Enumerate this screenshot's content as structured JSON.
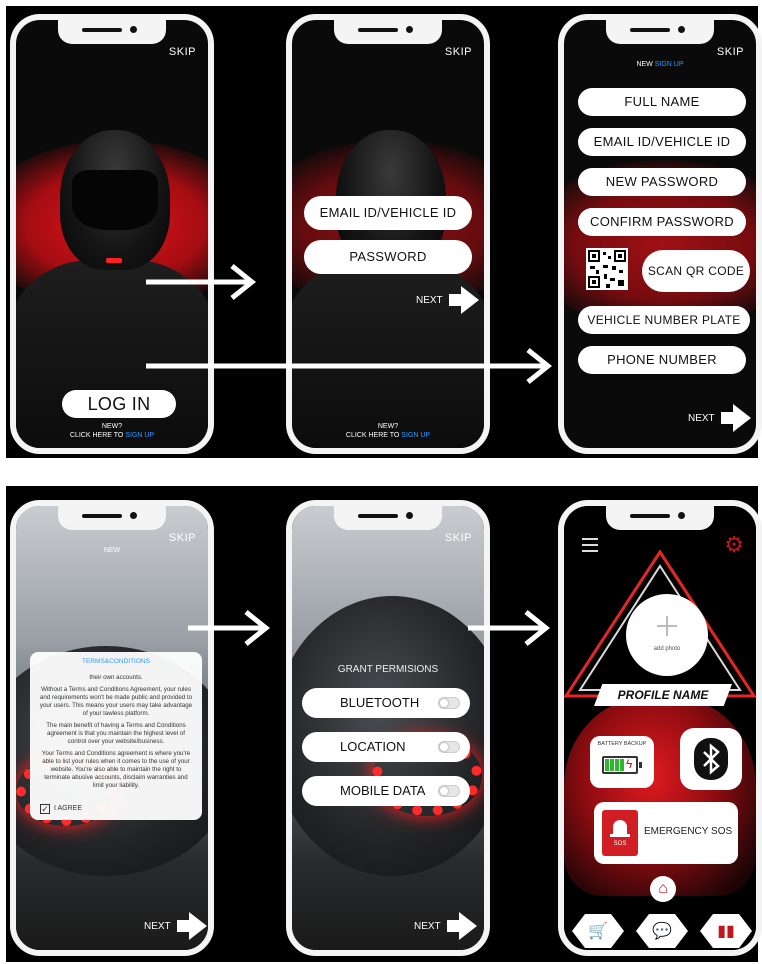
{
  "screens": {
    "login": {
      "skip": "SKIP",
      "login_button": "LOG IN",
      "new_line": "NEW?",
      "click_here": "CLICK HERE TO ",
      "sign_up": "SIGN UP"
    },
    "credentials": {
      "skip": "SKIP",
      "email_field": "EMAIL ID/VEHICLE ID",
      "password_field": "PASSWORD",
      "next": "NEXT",
      "new_line": "NEW?",
      "click_here": "CLICK HERE TO ",
      "sign_up": "SIGN UP"
    },
    "signup": {
      "skip": "SKIP",
      "title_prefix": "NEW ",
      "title_accent": "SIGN UP",
      "full_name": "FULL NAME",
      "email": "EMAIL ID/VEHICLE ID",
      "new_password": "NEW PASSWORD",
      "confirm_password": "CONFIRM PASSWORD",
      "scan_qr": "SCAN QR CODE",
      "vehicle_plate": "VEHICLE NUMBER PLATE",
      "phone": "PHONE NUMBER",
      "next": "NEXT"
    },
    "terms": {
      "skip": "SKIP",
      "title_prefix": "NEW ",
      "heading": "TERMS&CONDITIONS",
      "p1": "their own accounts.",
      "p2": "Without a Terms and Conditions Agreement, your rules and requirements won't be made public and provided to your users. This means your users may take advantage of your lawless platform.",
      "p3": "The main benefit of having a Terms and Conditions agreement is that you maintain the highest level of control over your website/business.",
      "p4": "Your Terms and Conditions agreement is where you're able to list your rules when it comes to the use of your website. You're also able to maintain the right to terminate abusive accounts, disclaim warranties and limit your liability.",
      "agree": "I AGREE",
      "next": "NEXT"
    },
    "permissions": {
      "skip": "SKIP",
      "heading": "GRANT PERMISIONS",
      "bluetooth": "BLUETOOTH",
      "location": "LOCATION",
      "mobile_data": "MOBILE DATA",
      "next": "NEXT"
    },
    "dashboard": {
      "add_photo": "add photo",
      "profile_name": "PROFILE NAME",
      "battery": "BATTERY BACKUP",
      "sos_badge": "SOS",
      "emergency": "EMERGENCY SOS"
    }
  },
  "colors": {
    "accent_red": "#c2161c",
    "link_blue": "#2b9bff",
    "background": "#000000"
  }
}
